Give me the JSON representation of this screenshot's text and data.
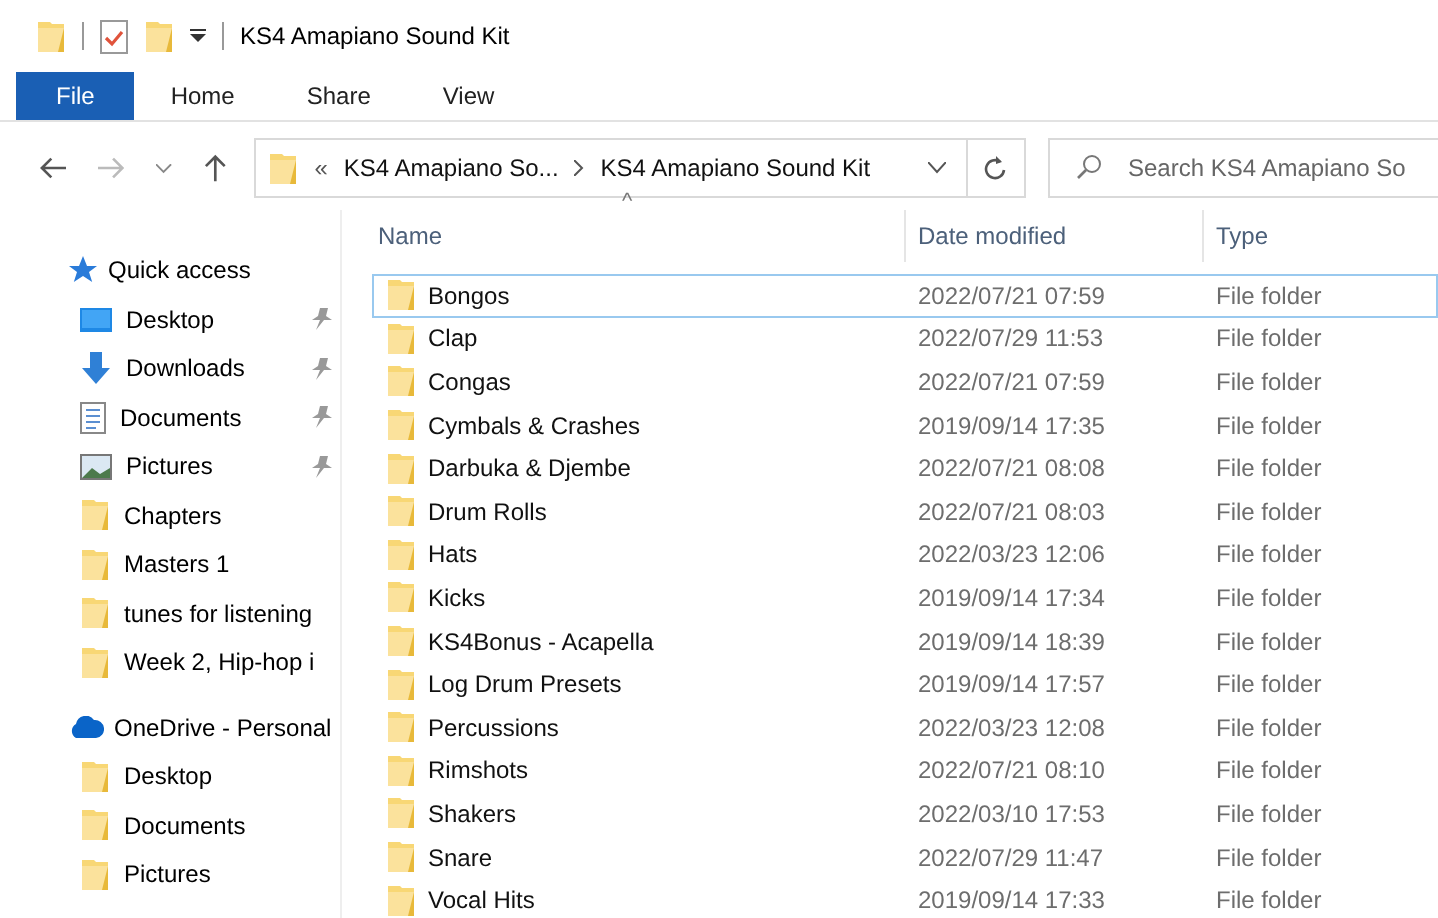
{
  "window": {
    "title": "KS4 Amapiano Sound Kit"
  },
  "ribbon_tabs": [
    {
      "label": "File",
      "selected": true
    },
    {
      "label": "Home",
      "selected": false
    },
    {
      "label": "Share",
      "selected": false
    },
    {
      "label": "View",
      "selected": false
    }
  ],
  "address_bar": {
    "overflow": "«",
    "crumbs": [
      "KS4 Amapiano So...",
      "KS4 Amapiano Sound Kit"
    ]
  },
  "search": {
    "placeholder": "Search KS4 Amapiano So"
  },
  "sidebar": {
    "groups": [
      {
        "label": "Quick access",
        "kind": "star",
        "items": [
          {
            "label": "Desktop",
            "kind": "desktop",
            "pinned": true
          },
          {
            "label": "Downloads",
            "kind": "downloads",
            "pinned": true
          },
          {
            "label": "Documents",
            "kind": "documents",
            "pinned": true
          },
          {
            "label": "Pictures",
            "kind": "pictures",
            "pinned": true
          },
          {
            "label": "Chapters",
            "kind": "folder",
            "pinned": false
          },
          {
            "label": "Masters 1",
            "kind": "folder",
            "pinned": false
          },
          {
            "label": "tunes for listening",
            "kind": "folder",
            "pinned": false
          },
          {
            "label": "Week 2, Hip-hop i",
            "kind": "folder",
            "pinned": false
          }
        ]
      },
      {
        "label": "OneDrive - Personal",
        "kind": "cloud",
        "items": [
          {
            "label": "Desktop",
            "kind": "folder",
            "pinned": false
          },
          {
            "label": "Documents",
            "kind": "folder",
            "pinned": false
          },
          {
            "label": "Pictures",
            "kind": "folder",
            "pinned": false
          }
        ]
      }
    ]
  },
  "table": {
    "sort_indicator": "^",
    "columns": [
      "Name",
      "Date modified",
      "Type"
    ],
    "rows": [
      {
        "name": "Bongos",
        "date": "2022/07/21 07:59",
        "type": "File folder",
        "focused": true
      },
      {
        "name": "Clap",
        "date": "2022/07/29 11:53",
        "type": "File folder",
        "focused": false
      },
      {
        "name": "Congas",
        "date": "2022/07/21 07:59",
        "type": "File folder",
        "focused": false
      },
      {
        "name": "Cymbals & Crashes",
        "date": "2019/09/14 17:35",
        "type": "File folder",
        "focused": false
      },
      {
        "name": "Darbuka & Djembe",
        "date": "2022/07/21 08:08",
        "type": "File folder",
        "focused": false
      },
      {
        "name": "Drum Rolls",
        "date": "2022/07/21 08:03",
        "type": "File folder",
        "focused": false
      },
      {
        "name": "Hats",
        "date": "2022/03/23 12:06",
        "type": "File folder",
        "focused": false
      },
      {
        "name": "Kicks",
        "date": "2019/09/14 17:34",
        "type": "File folder",
        "focused": false
      },
      {
        "name": "KS4Bonus - Acapella",
        "date": "2019/09/14 18:39",
        "type": "File folder",
        "focused": false
      },
      {
        "name": "Log Drum Presets",
        "date": "2019/09/14 17:57",
        "type": "File folder",
        "focused": false
      },
      {
        "name": "Percussions",
        "date": "2022/03/23 12:08",
        "type": "File folder",
        "focused": false
      },
      {
        "name": "Rimshots",
        "date": "2022/07/21 08:10",
        "type": "File folder",
        "focused": false
      },
      {
        "name": "Shakers",
        "date": "2022/03/10 17:53",
        "type": "File folder",
        "focused": false
      },
      {
        "name": "Snare",
        "date": "2022/07/29 11:47",
        "type": "File folder",
        "focused": false
      },
      {
        "name": "Vocal Hits",
        "date": "2019/09/14 17:33",
        "type": "File folder",
        "focused": false
      }
    ]
  }
}
